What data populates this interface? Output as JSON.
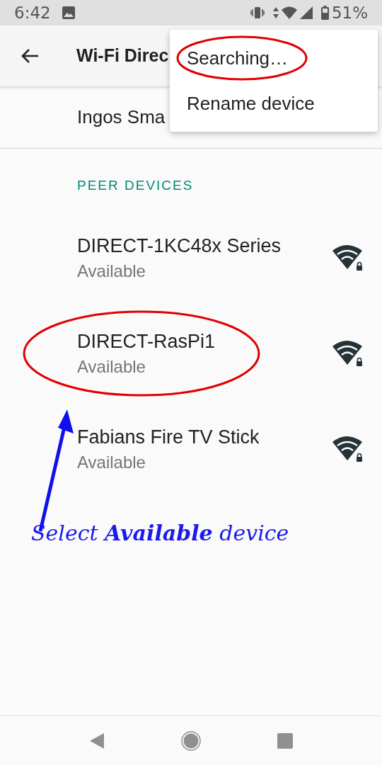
{
  "status_bar": {
    "time": "6:42",
    "battery": "51%"
  },
  "app_bar": {
    "title": "Wi-Fi Direc"
  },
  "overflow_menu": {
    "items": [
      {
        "label": "Searching…",
        "circled": true
      },
      {
        "label": "Rename device",
        "circled": false
      }
    ]
  },
  "this_device": {
    "name": "Ingos Sma"
  },
  "section_header": "PEER DEVICES",
  "peers": [
    {
      "name": "DIRECT-1KC48x Series",
      "status": "Available",
      "secured": true,
      "circled": false
    },
    {
      "name": "DIRECT-RasPi1",
      "status": "Available",
      "secured": true,
      "circled": true
    },
    {
      "name": "Fabians Fire TV Stick",
      "status": "Available",
      "secured": true,
      "circled": false
    }
  ],
  "annotation": {
    "text": "Select **Available** device"
  }
}
